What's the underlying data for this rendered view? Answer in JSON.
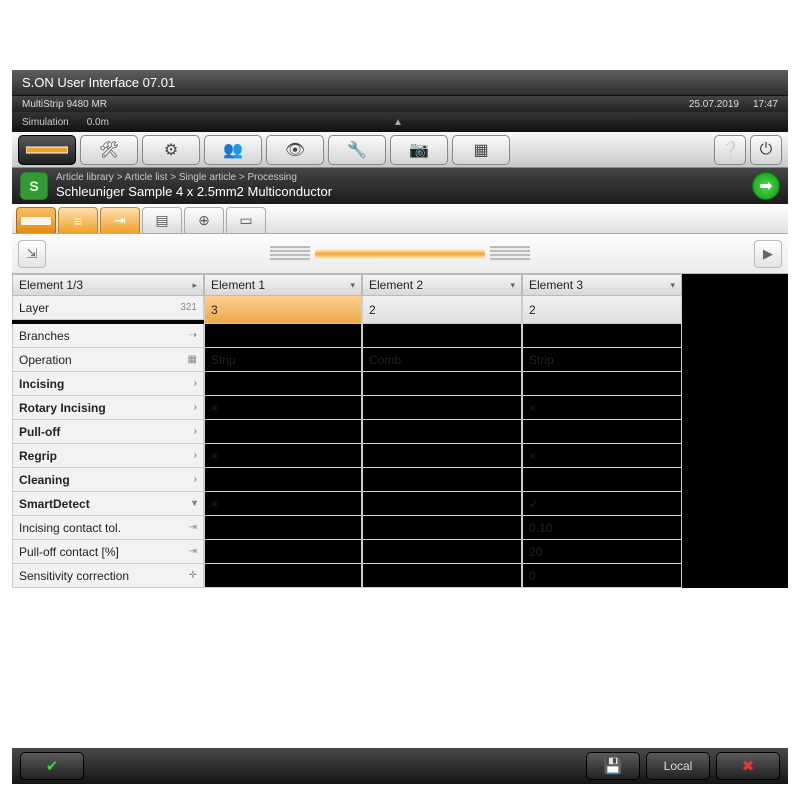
{
  "titlebar": "S.ON User Interface 07.01",
  "status": {
    "machine": "MultiStrip 9480 MR",
    "date": "25.07.2019",
    "time": "17:47",
    "mode": "Simulation",
    "length": "0.0m"
  },
  "breadcrumb": "Article library > Article list > Single article > Processing",
  "article_title": "Schleuniger Sample 4 x 2.5mm2 Multiconductor",
  "columns": {
    "row_header": "Element 1/3",
    "c1": "Element 1",
    "c2": "Element 2",
    "c3": "Element 3"
  },
  "rows": [
    {
      "label": "Layer",
      "bold": false,
      "hl": true,
      "icon": "321",
      "v": [
        "3",
        "2",
        "2"
      ]
    },
    {
      "label": "Branches",
      "bold": false,
      "icon": "⇢",
      "v": [
        "",
        "",
        ""
      ]
    },
    {
      "label": "Operation",
      "bold": false,
      "icon": "▦",
      "v": [
        "Strip",
        "Comb",
        "Strip"
      ]
    },
    {
      "label": "Incising",
      "bold": true,
      "icon": "›",
      "v": [
        "",
        "",
        ""
      ]
    },
    {
      "label": "Rotary Incising",
      "bold": true,
      "icon": "›",
      "v": [
        "×",
        "",
        "×"
      ]
    },
    {
      "label": "Pull-off",
      "bold": true,
      "icon": "›",
      "v": [
        "",
        "",
        ""
      ]
    },
    {
      "label": "Regrip",
      "bold": true,
      "icon": "›",
      "v": [
        "×",
        "",
        "×"
      ]
    },
    {
      "label": "Cleaning",
      "bold": true,
      "icon": "›",
      "v": [
        "",
        "",
        ""
      ]
    },
    {
      "label": "SmartDetect",
      "bold": true,
      "icon": "▾",
      "v": [
        "×",
        "",
        "✓"
      ]
    },
    {
      "label": "Incising contact tol.",
      "bold": false,
      "icon": "⇥",
      "v": [
        "",
        "",
        "0.10"
      ]
    },
    {
      "label": "Pull-off contact [%]",
      "bold": false,
      "icon": "⇥",
      "v": [
        "",
        "",
        "20"
      ]
    },
    {
      "label": "Sensitivity correction",
      "bold": false,
      "icon": "✛",
      "v": [
        "",
        "",
        "0"
      ]
    }
  ],
  "footer": {
    "local": "Local"
  }
}
